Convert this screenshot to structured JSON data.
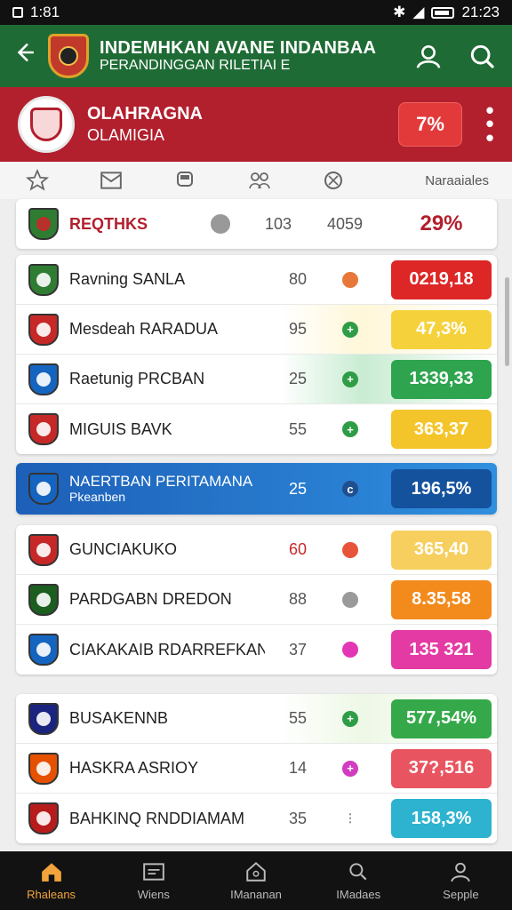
{
  "status_bar": {
    "time_left": "1:81",
    "time_right": "21:23"
  },
  "app_bar": {
    "title": "INDEMHKAN AVANE INDANBAA",
    "subtitle": "PERANDINGGAN RILETIAI E",
    "icons": [
      "back-arrow-icon",
      "person-icon",
      "search-icon"
    ]
  },
  "team_header": {
    "name": "OLAHRAGNA",
    "subname": "OLAMIGIA",
    "percent": "7%"
  },
  "tabs": {
    "last_label": "Naraaiales"
  },
  "summary_row": {
    "name": "REQTHKS",
    "num": "103",
    "code": "4059",
    "value": "29%"
  },
  "groups": [
    {
      "rows": [
        {
          "name": "Ravning SANLA",
          "num": "80",
          "dot": "",
          "value": "0219,18",
          "dot_color": "#e8783a",
          "val_color": "#dd2626",
          "tint": ""
        },
        {
          "name": "Mesdeah RARADUA",
          "num": "95",
          "dot": "+",
          "value": "47,3%",
          "dot_color": "#2e9d46",
          "val_color": "#f5d23c",
          "tint": "#fff7d9"
        },
        {
          "name": "Raetunig PRCBAN",
          "num": "25",
          "dot": "+",
          "value": "1339,33",
          "dot_color": "#2e9d46",
          "val_color": "#2ea44f",
          "tint": "#c9ecd2"
        },
        {
          "name": "MIGUIS BAVK",
          "num": "55",
          "dot": "+",
          "value": "363,37",
          "dot_color": "#2e9d46",
          "val_color": "#f4c52a",
          "tint": ""
        }
      ]
    },
    {
      "rows": [
        {
          "name": "NAERTBAN PERITAMANA",
          "sub": "Pkeanben",
          "num": "25",
          "dot": "c",
          "value": "196,5%",
          "dot_color": "#1f4f8f",
          "val_color": "#15529e",
          "tint": "",
          "highlight": true
        }
      ]
    },
    {
      "rows": [
        {
          "name": "GUNCIAKUKO",
          "num": "60",
          "dot": "",
          "value": "365,40",
          "dot_color": "#e8543a",
          "val_color": "#f6cf5e",
          "tint": "",
          "num_color": "#c62828"
        },
        {
          "name": "PARDGABN DREDON",
          "num": "88",
          "dot": "",
          "value": "8.35,58",
          "dot_color": "#9a9a9a",
          "val_color": "#f28a1c",
          "tint": ""
        },
        {
          "name": "CIAKAKAIB RDARREFKAN",
          "num": "37",
          "dot": "",
          "value": "135 321",
          "dot_color": "#e236b5",
          "val_color": "#e43aa3",
          "tint": ""
        }
      ]
    },
    {
      "rows": [
        {
          "name": "BUSAKENNB",
          "num": "55",
          "dot": "+",
          "value": "577,54%",
          "dot_color": "#2e9d46",
          "val_color": "#35a94a",
          "tint": "#eef8e6"
        },
        {
          "name": "HASKRA ASRIOY",
          "num": "14",
          "dot": "+",
          "value": "37?,516",
          "dot_color": "#d23cc0",
          "val_color": "#e8545f",
          "tint": ""
        },
        {
          "name": "BAHKINQ RNDDIAMAM",
          "num": "35",
          "dot": "⋮",
          "value": "158,3%",
          "dot_color": "#ffffff",
          "val_color": "#2db3cf",
          "tint": ""
        }
      ]
    }
  ],
  "bottom_nav": [
    {
      "label": "Rhaleans",
      "icon": "home-icon",
      "active": true
    },
    {
      "label": "Wiens",
      "icon": "mail-icon",
      "active": false
    },
    {
      "label": "IMananan",
      "icon": "house-icon",
      "active": false
    },
    {
      "label": "IMadaes",
      "icon": "search-icon",
      "active": false
    },
    {
      "label": "Sepple",
      "icon": "person-icon",
      "active": false
    }
  ]
}
